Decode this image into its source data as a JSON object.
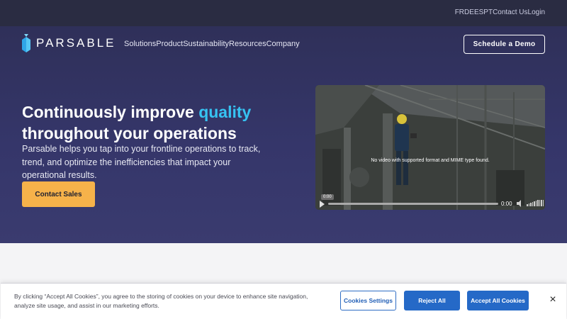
{
  "utility_nav": {
    "links": [
      "FR",
      "DE",
      "ES",
      "PT",
      "Contact Us",
      "Login"
    ]
  },
  "brand": {
    "name": "PARSABLE",
    "logo_icon": "parsable-logo-icon"
  },
  "main_nav": {
    "items": [
      "Solutions",
      "Product",
      "Sustainability",
      "Resources",
      "Company"
    ]
  },
  "header": {
    "demo_button": "Schedule a Demo"
  },
  "hero": {
    "headline_pre": "Continuously improve ",
    "headline_accent": "quality",
    "headline_post": "throughout your operations",
    "subtext": "Parsable helps you tap into your frontline operations to track, trend, and optimize the inefficiencies that impact your operational results.",
    "cta": "Contact Sales",
    "accent_color": "#36c3f2",
    "cta_color": "#f6b24a"
  },
  "video": {
    "message": "No video with supported format and MIME type found.",
    "time_tooltip": "0:00",
    "time_display": "0:00"
  },
  "cookie_banner": {
    "text": "By clicking “Accept All Cookies”, you agree to the storing of cookies on your device to enhance site navigation, analyze site usage, and assist in our marketing efforts.",
    "settings_button": "Cookies Settings",
    "reject_button": "Reject All",
    "accept_button": "Accept All Cookies",
    "close_label": "×"
  }
}
